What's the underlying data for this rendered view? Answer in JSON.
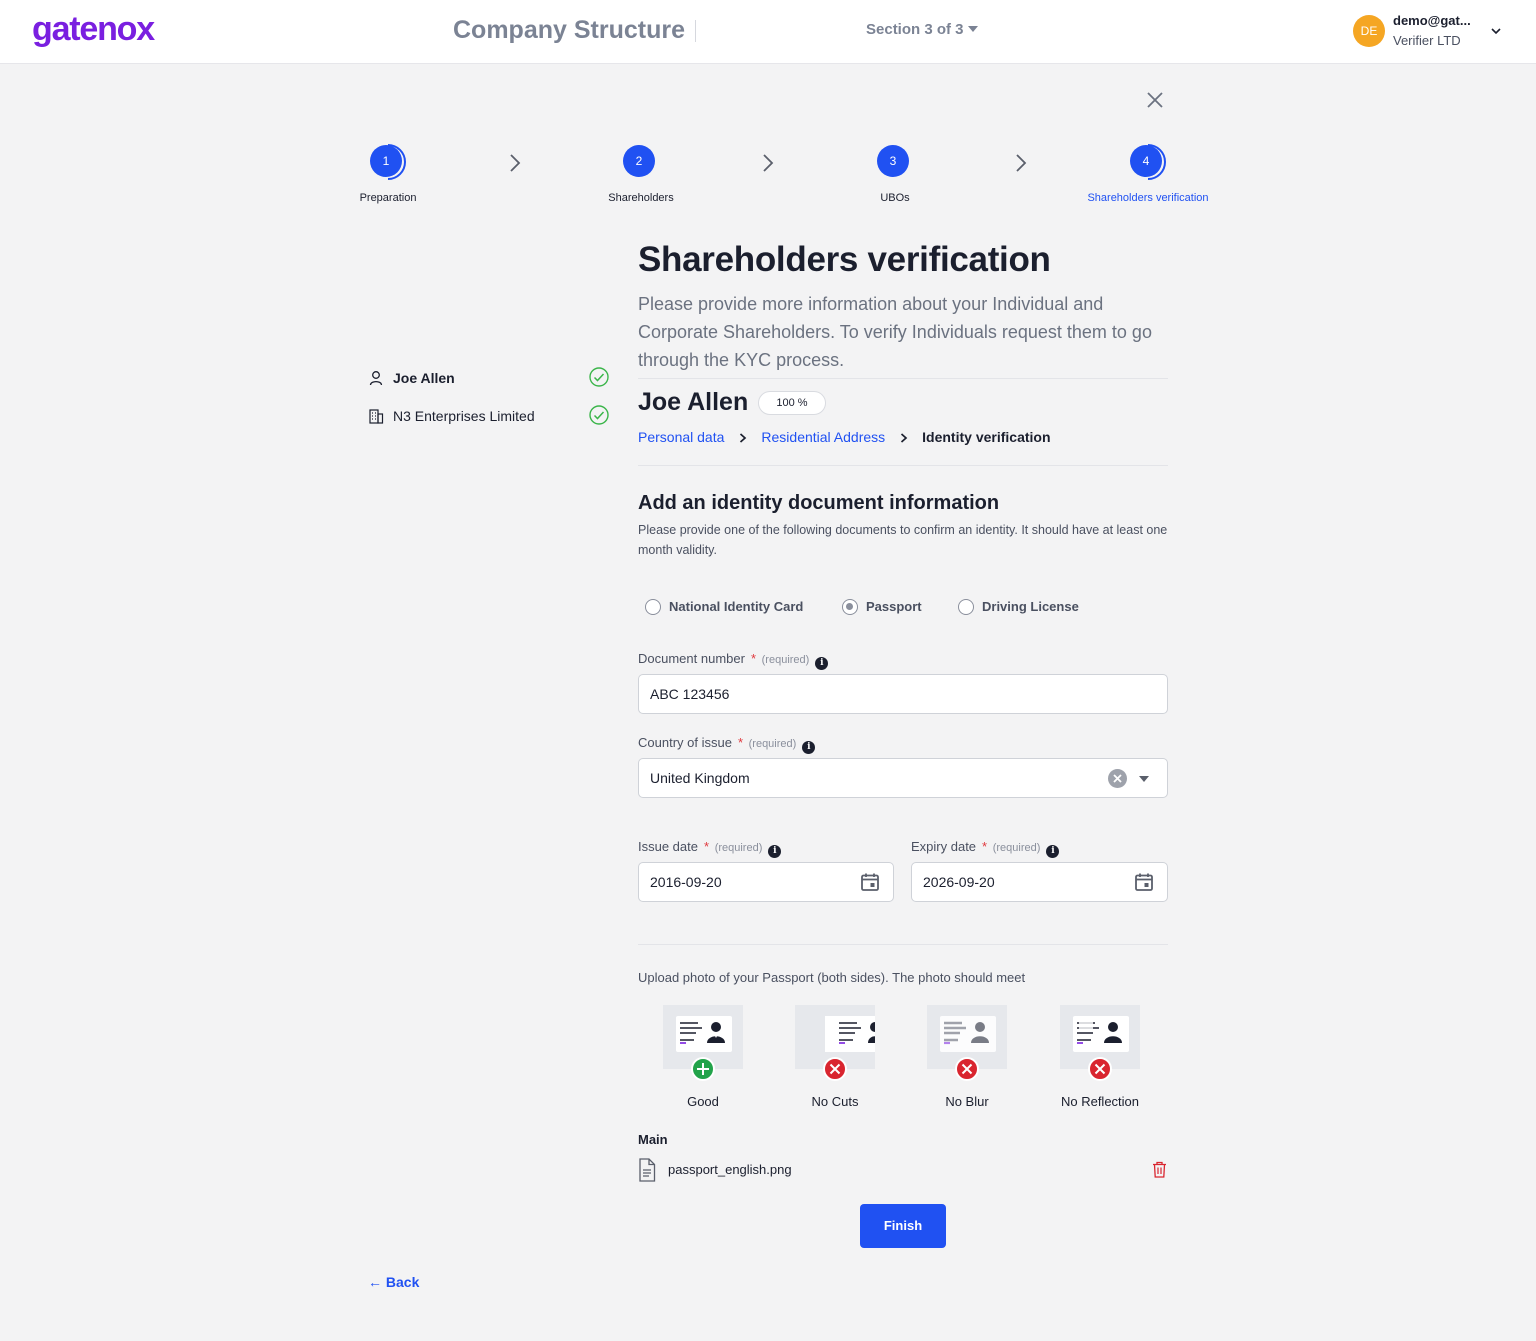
{
  "header": {
    "logo": "gatenox",
    "title": "Company Structure",
    "section": "Section 3 of 3",
    "user_initials": "DE",
    "user_email": "demo@gat...",
    "user_org": "Verifier LTD"
  },
  "steps": [
    {
      "number": "1",
      "label": "Preparation"
    },
    {
      "number": "2",
      "label": "Shareholders"
    },
    {
      "number": "3",
      "label": "UBOs"
    },
    {
      "number": "4",
      "label": "Shareholders verification"
    }
  ],
  "sidebar": {
    "items": [
      {
        "label": "Joe Allen",
        "type": "person",
        "status": "complete"
      },
      {
        "label": "N3 Enterprises Limited",
        "type": "company",
        "status": "complete"
      }
    ]
  },
  "page": {
    "title": "Shareholders verification",
    "intro": "Please provide more information about your Individual and Corporate Shareholders. To verify Individuals request them to go through the KYC process."
  },
  "person": {
    "name": "Joe Allen",
    "progress": "100 %",
    "breadcrumbs": [
      "Personal data",
      "Residential Address",
      "Identity verification"
    ]
  },
  "identity": {
    "title": "Add an identity document information",
    "description": "Please provide one of the following documents to confirm an identity. It should have at least one month validity.",
    "doc_types": [
      "National Identity Card",
      "Passport",
      "Driving License"
    ],
    "selected_doc_type": "Passport"
  },
  "form": {
    "required_star": "*",
    "required_text": "(required)",
    "info_glyph": "i",
    "document_number": {
      "label": "Document number",
      "value": "ABC 123456"
    },
    "country": {
      "label": "Country of issue",
      "value": "United Kingdom"
    },
    "issue_date": {
      "label": "Issue date",
      "value": "2016-09-20"
    },
    "expiry_date": {
      "label": "Expiry date",
      "value": "2026-09-20"
    }
  },
  "upload": {
    "instruction": "Upload photo of your Passport (both sides). The photo should meet",
    "rules": [
      {
        "caption": "Good",
        "icon": "plus-icon",
        "color": "#22a34a"
      },
      {
        "caption": "No Cuts",
        "icon": "x-icon",
        "color": "#d9252f"
      },
      {
        "caption": "No Blur",
        "icon": "x-icon",
        "color": "#d9252f"
      },
      {
        "caption": "No Reflection",
        "icon": "x-icon",
        "color": "#d9252f"
      }
    ],
    "section_label": "Main",
    "file_name": "passport_english.png"
  },
  "actions": {
    "finish": "Finish",
    "back": "← Back"
  },
  "colors": {
    "brand": "#7a1fe0",
    "primary": "#2051f2",
    "success": "#3bb54a",
    "danger": "#d9252f",
    "avatar": "#f5a623"
  }
}
